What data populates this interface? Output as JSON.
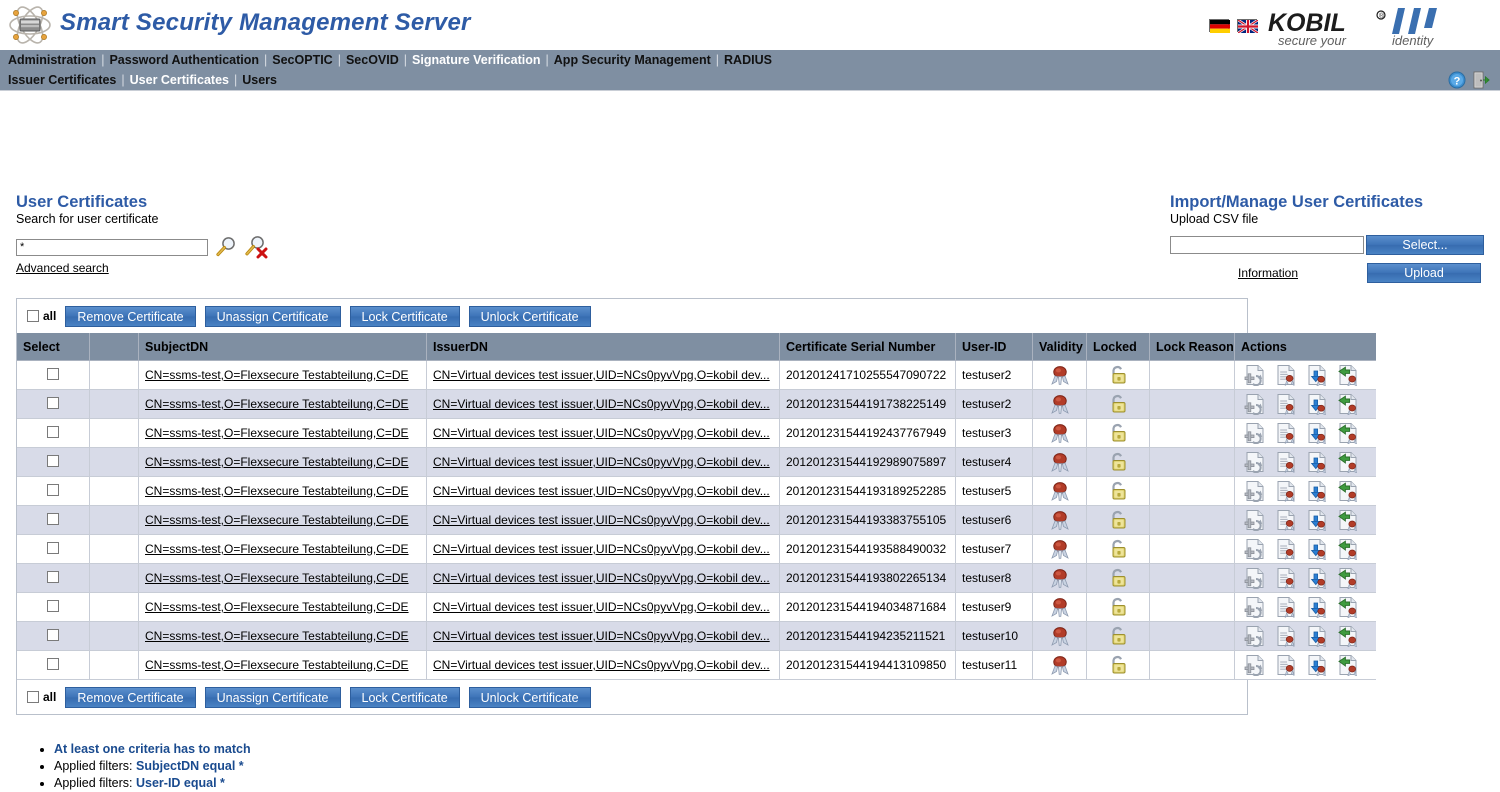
{
  "app": {
    "title": "Smart Security Management Server",
    "logo_icon": "atom-chip-icon",
    "brand_logo": "kobil-logo",
    "brand_name": "KOBIL",
    "brand_tagline": "secure your identity",
    "accent_color": "#2e5ba6",
    "nav_bg_color": "#7f8fa2"
  },
  "languages": [
    {
      "name": "german-flag-icon",
      "label": "Deutsch"
    },
    {
      "name": "english-flag-icon",
      "label": "English"
    }
  ],
  "nav_icons": [
    {
      "name": "help-icon",
      "label": "Help"
    },
    {
      "name": "logout-icon",
      "label": "Logout"
    }
  ],
  "nav": {
    "primary": [
      {
        "label": "Administration",
        "active": false
      },
      {
        "label": "Password Authentication",
        "active": false
      },
      {
        "label": "SecOPTIC",
        "active": false
      },
      {
        "label": "SecOVID",
        "active": false
      },
      {
        "label": "Signature Verification",
        "active": true
      },
      {
        "label": "App Security Management",
        "active": false
      },
      {
        "label": "RADIUS",
        "active": false
      }
    ],
    "secondary": [
      {
        "label": "Issuer Certificates",
        "active": false
      },
      {
        "label": "User Certificates",
        "active": true
      },
      {
        "label": "Users",
        "active": false
      }
    ],
    "separator": "|"
  },
  "search_panel": {
    "heading": "User Certificates",
    "subtitle": "Search for user certificate",
    "input_value": "*",
    "input_placeholder": "",
    "search_icon": "search-icon",
    "clear_search_icon": "clear-search-icon",
    "advanced_link": "Advanced search"
  },
  "import_panel": {
    "heading": "Import/Manage User Certificates",
    "subtitle": "Upload CSV file",
    "file_value": "",
    "file_placeholder": "",
    "select_label": "Select...",
    "upload_label": "Upload",
    "information_label": "Information"
  },
  "toolbar": {
    "all_label": "all",
    "buttons": [
      "Remove Certificate",
      "Unassign Certificate",
      "Lock Certificate",
      "Unlock Certificate"
    ]
  },
  "table": {
    "columns": [
      "Select",
      "",
      "SubjectDN",
      "IssuerDN",
      "Certificate Serial Number",
      "User-ID",
      "Validity",
      "Locked",
      "Lock Reason",
      "Actions"
    ],
    "subject_dn": "CN=ssms-test,O=Flexsecure Testabteilung,C=DE",
    "issuer_dn": "CN=Virtual devices test issuer,UID=NCs0pyvVpg,O=kobil dev...",
    "validity_icon": "certificate-seal-icon",
    "locked_icon": "open-padlock-icon",
    "action_icons": [
      "assign-certificate-icon",
      "show-certificate-icon",
      "download-certificate-icon",
      "unassign-certificate-icon"
    ],
    "rows": [
      {
        "serial": "201201241710255547090722",
        "user_id": "testuser2",
        "lock_reason": ""
      },
      {
        "serial": "201201231544191738225149",
        "user_id": "testuser2",
        "lock_reason": ""
      },
      {
        "serial": "201201231544192437767949",
        "user_id": "testuser3",
        "lock_reason": ""
      },
      {
        "serial": "201201231544192989075897",
        "user_id": "testuser4",
        "lock_reason": ""
      },
      {
        "serial": "201201231544193189252285",
        "user_id": "testuser5",
        "lock_reason": ""
      },
      {
        "serial": "201201231544193383755105",
        "user_id": "testuser6",
        "lock_reason": ""
      },
      {
        "serial": "201201231544193588490032",
        "user_id": "testuser7",
        "lock_reason": ""
      },
      {
        "serial": "201201231544193802265134",
        "user_id": "testuser8",
        "lock_reason": ""
      },
      {
        "serial": "201201231544194034871684",
        "user_id": "testuser9",
        "lock_reason": ""
      },
      {
        "serial": "201201231544194235211521",
        "user_id": "testuser10",
        "lock_reason": ""
      },
      {
        "serial": "201201231544194413109850",
        "user_id": "testuser11",
        "lock_reason": ""
      }
    ]
  },
  "notes": [
    {
      "prefix": "",
      "bold": "At least one criteria has to match"
    },
    {
      "prefix": "Applied filters: ",
      "bold": "SubjectDN equal *"
    },
    {
      "prefix": "Applied filters: ",
      "bold": "User-ID equal *"
    }
  ]
}
